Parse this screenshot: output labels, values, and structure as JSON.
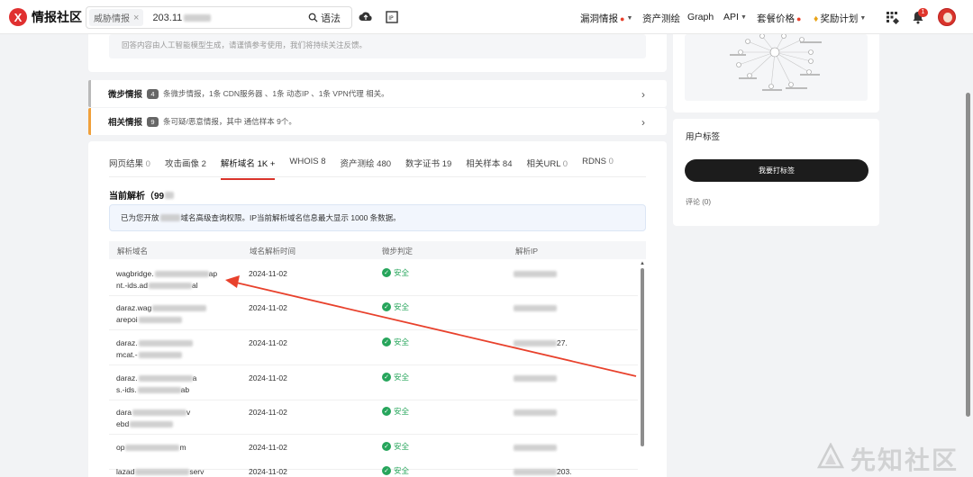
{
  "app": {
    "logo_text": "情报社区",
    "logo_mark": "X"
  },
  "search": {
    "tag_label": "威胁情报",
    "tag_close": "×",
    "query_visible": "203.11",
    "syntax_label": "语法"
  },
  "nav": {
    "vuln_intel": "漏洞情报",
    "asset_mapping": "资产测绘",
    "graph": "Graph",
    "api": "API",
    "pricing": "套餐价格",
    "rewards": "奖励计划",
    "notification_count": "1"
  },
  "ai_note": "回答内容由人工智能模型生成，请谨慎参考使用，我们将持续关注反馈。",
  "intel_rows": [
    {
      "label": "微步情报",
      "count": "4",
      "desc": "条微步情报，1条 CDN服务器 、1条 动态IP 、1条 VPN代理 相关。",
      "accent": "#b9b9b9"
    },
    {
      "label": "相关情报",
      "count": "9",
      "desc": "条可疑/恶意情报，其中 通信样本 9个。",
      "accent": "#f0a03c"
    }
  ],
  "tabs": [
    {
      "label": "网页结果",
      "count": "0"
    },
    {
      "label": "攻击画像",
      "count": "2"
    },
    {
      "label": "解析域名",
      "count": "1K +",
      "active": true
    },
    {
      "label": "WHOIS",
      "count": "8"
    },
    {
      "label": "资产测绘",
      "count": "480"
    },
    {
      "label": "数字证书",
      "count": "19"
    },
    {
      "label": "相关样本",
      "count": "84"
    },
    {
      "label": "相关URL",
      "count": "0"
    },
    {
      "label": "RDNS",
      "count": "0"
    }
  ],
  "current_resolution": {
    "title": "当前解析",
    "count_visible": "（99"
  },
  "notice": {
    "prefix": "已为您开放",
    "suffix": "域名高级查询权限。IP当前解析域名信息最大显示 1000 条数据。"
  },
  "table": {
    "headers": [
      "解析域名",
      "域名解析时间",
      "微步判定",
      "解析IP"
    ],
    "rows": [
      {
        "domain_l1": "wagbridge.",
        "domain_l1_tail": "ap",
        "domain_l2": "nt.-ids.ad",
        "domain_l2_tail": "al",
        "date": "2024-11-02",
        "verdict": "安全",
        "ip_visible": ""
      },
      {
        "domain_l1": "daraz.wag",
        "domain_l1_tail": "",
        "domain_l2": "arepoi",
        "domain_l2_tail": "",
        "date": "2024-11-02",
        "verdict": "安全",
        "ip_visible": ""
      },
      {
        "domain_l1": "daraz.",
        "domain_l1_tail": "",
        "domain_l2": "mcat.-",
        "domain_l2_tail": "",
        "date": "2024-11-02",
        "verdict": "安全",
        "ip_visible": "27."
      },
      {
        "domain_l1": "daraz.",
        "domain_l1_tail": "a",
        "domain_l2": "s.-ids.",
        "domain_l2_tail": "ab",
        "date": "2024-11-02",
        "verdict": "安全",
        "ip_visible": ""
      },
      {
        "domain_l1": "dara",
        "domain_l1_tail": "v",
        "domain_l2": "ebd",
        "domain_l2_tail": "",
        "date": "2024-11-02",
        "verdict": "安全",
        "ip_visible": ""
      },
      {
        "domain_l1": "op",
        "domain_l1_tail": "m",
        "domain_l2": "",
        "domain_l2_tail": "",
        "date": "2024-11-02",
        "verdict": "安全",
        "ip_visible": ""
      },
      {
        "domain_l1": "lazad",
        "domain_l1_tail": "serv",
        "domain_l2": "",
        "domain_l2_tail": "",
        "date": "2024-11-02",
        "verdict": "安全",
        "ip_visible": "203."
      }
    ]
  },
  "sidebar": {
    "user_tags_title": "用户标签",
    "tag_button": "我要打标签",
    "comments": "评论 (0)"
  },
  "watermark": "先知社区",
  "colors": {
    "brand": "#d9342b",
    "safe": "#26a55b",
    "annotation_arrow": "#e8412c"
  }
}
